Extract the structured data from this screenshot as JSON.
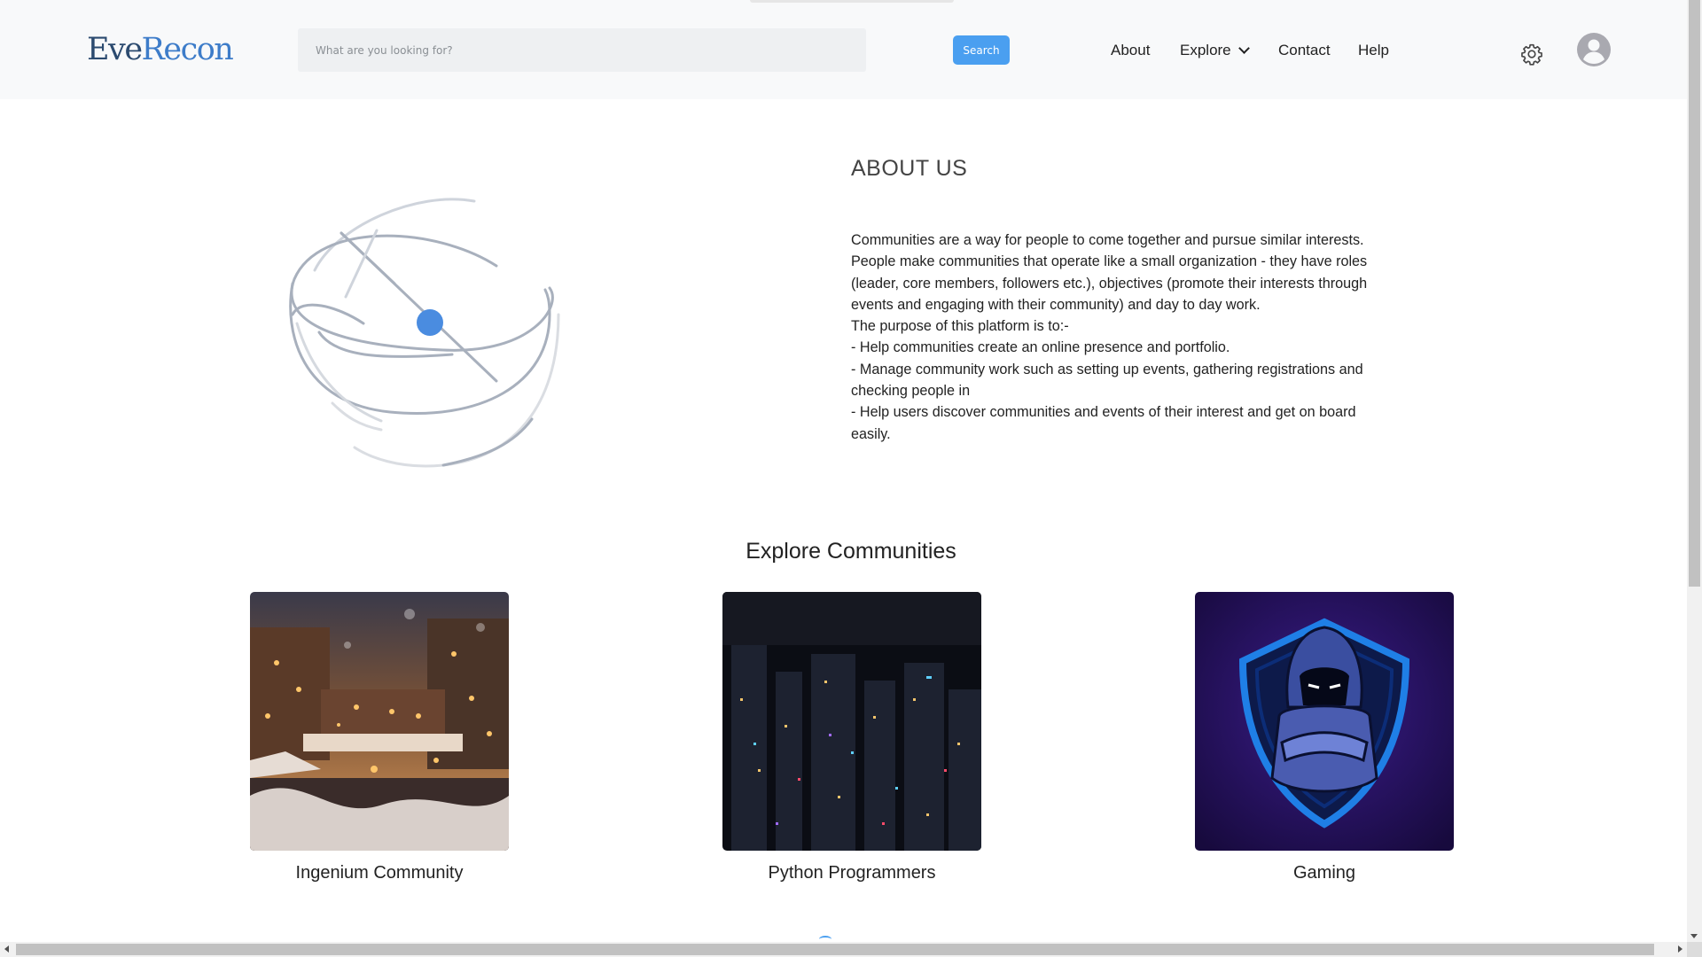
{
  "header": {
    "logo_part1": "Eve",
    "logo_part2": "Recon",
    "search": {
      "placeholder": "What are you looking for?",
      "value": ""
    },
    "search_button_label": "Search",
    "nav": {
      "about": "About",
      "explore": "Explore",
      "contact": "Contact",
      "help": "Help"
    },
    "icons": {
      "settings": "gear-icon",
      "profile": "user-avatar-icon",
      "dropdown": "chevron-down-icon"
    }
  },
  "about": {
    "title": "ABOUT US",
    "lines": [
      "Communities are a way for people to come together and pursue similar interests. People make communities that operate like a small organization - they have roles (leader, core members, followers etc.), objectives (promote their interests through events and engaging with their community) and day to day work.",
      "The purpose of this platform is to:-",
      "- Help communities create an online presence and portfolio.",
      "- Manage community work such as setting up events, gathering registrations and checking people in",
      "- Help users discover communities and events of their interest and get on board easily."
    ]
  },
  "explore": {
    "title": "Explore Communities",
    "communities": [
      {
        "name": "Ingenium Community",
        "image": "snowy-town-night-image"
      },
      {
        "name": "Python Programmers",
        "image": "city-night-skyline-image"
      },
      {
        "name": "Gaming",
        "image": "hooded-shield-mascot-image"
      }
    ]
  },
  "colors": {
    "accent": "#4a9ff0",
    "header_bg": "#f8f9fa",
    "logo_dark": "#2b4a6f",
    "logo_light": "#3d7cc9"
  }
}
